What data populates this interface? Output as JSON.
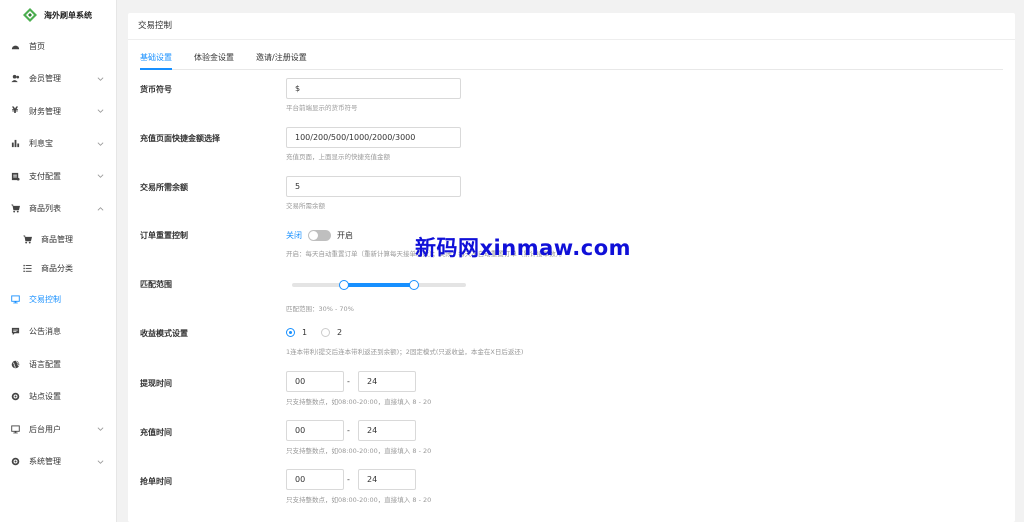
{
  "app": {
    "title": "海外刷单系统"
  },
  "sidebar": {
    "items": [
      {
        "label": "首页",
        "icon": "dashboard-icon"
      },
      {
        "label": "会员管理",
        "icon": "users-icon",
        "expandable": true
      },
      {
        "label": "财务管理",
        "icon": "yen-icon",
        "expandable": true
      },
      {
        "label": "利息宝",
        "icon": "bar-chart-icon",
        "expandable": true
      },
      {
        "label": "支付配置",
        "icon": "payment-icon",
        "expandable": true
      },
      {
        "label": "商品列表",
        "icon": "cart-icon",
        "expandable": true,
        "expanded": true
      },
      {
        "label": "商品管理",
        "icon": "cart-small-icon",
        "sub": true
      },
      {
        "label": "商品分类",
        "icon": "list-icon",
        "sub": true
      },
      {
        "label": "交易控制",
        "icon": "monitor-icon",
        "active": true
      },
      {
        "label": "公告消息",
        "icon": "message-icon"
      },
      {
        "label": "语言配置",
        "icon": "globe-icon"
      },
      {
        "label": "站点设置",
        "icon": "gear-icon"
      },
      {
        "label": "后台用户",
        "icon": "monitor-user-icon",
        "expandable": true
      },
      {
        "label": "系统管理",
        "icon": "settings-icon",
        "expandable": true
      }
    ]
  },
  "main": {
    "card_title": "交易控制",
    "tabs": [
      {
        "label": "基础设置",
        "active": true
      },
      {
        "label": "体验金设置"
      },
      {
        "label": "邀请/注册设置"
      }
    ],
    "form": {
      "currency": {
        "label": "货币符号",
        "value": "$",
        "hint": "平台前端显示的货币符号"
      },
      "quick_amounts": {
        "label": "充值页面快捷金额选择",
        "value": "100/200/500/1000/2000/3000",
        "hint": "充值页面，上面显示的快捷充值金额"
      },
      "min_balance": {
        "label": "交易所需余额",
        "value": "5",
        "hint": "交易所需余额"
      },
      "order_reset": {
        "label": "订单重置控制",
        "off_label": "关闭",
        "on_label": "开启",
        "enabled": false,
        "hint": "开启：每天自动重置订单（重新计算每天接单次数）；关闭：每天不自动重置订单（累计接单数）。"
      },
      "match_range": {
        "label": "匹配范围",
        "min": 30,
        "max": 70,
        "hint": "匹配范围：30% - 70%"
      },
      "profit_mode": {
        "label": "收益模式设置",
        "options": [
          "1",
          "2"
        ],
        "selected": "1",
        "hint": "1连本带利(提交后连本带利返还到余额)；2固定模式(只返收益，本金在X日后返还)"
      },
      "withdraw_time": {
        "label": "提现时间",
        "start": "00",
        "end": "24",
        "sep": "-",
        "hint": "只支持整数点，如08:00-20:00，直接填入 8 - 20"
      },
      "recharge_time": {
        "label": "充值时间",
        "start": "00",
        "end": "24",
        "sep": "-",
        "hint": "只支持整数点，如08:00-20:00，直接填入 8 - 20"
      },
      "grab_time": {
        "label": "抢单时间",
        "start": "00",
        "end": "24",
        "sep": "-",
        "hint": "只支持整数点，如08:00-20:00，直接填入 8 - 20"
      }
    }
  },
  "watermark": "新码网xinmaw.com",
  "colors": {
    "accent": "#1890ff",
    "watermark": "#1010d8"
  }
}
